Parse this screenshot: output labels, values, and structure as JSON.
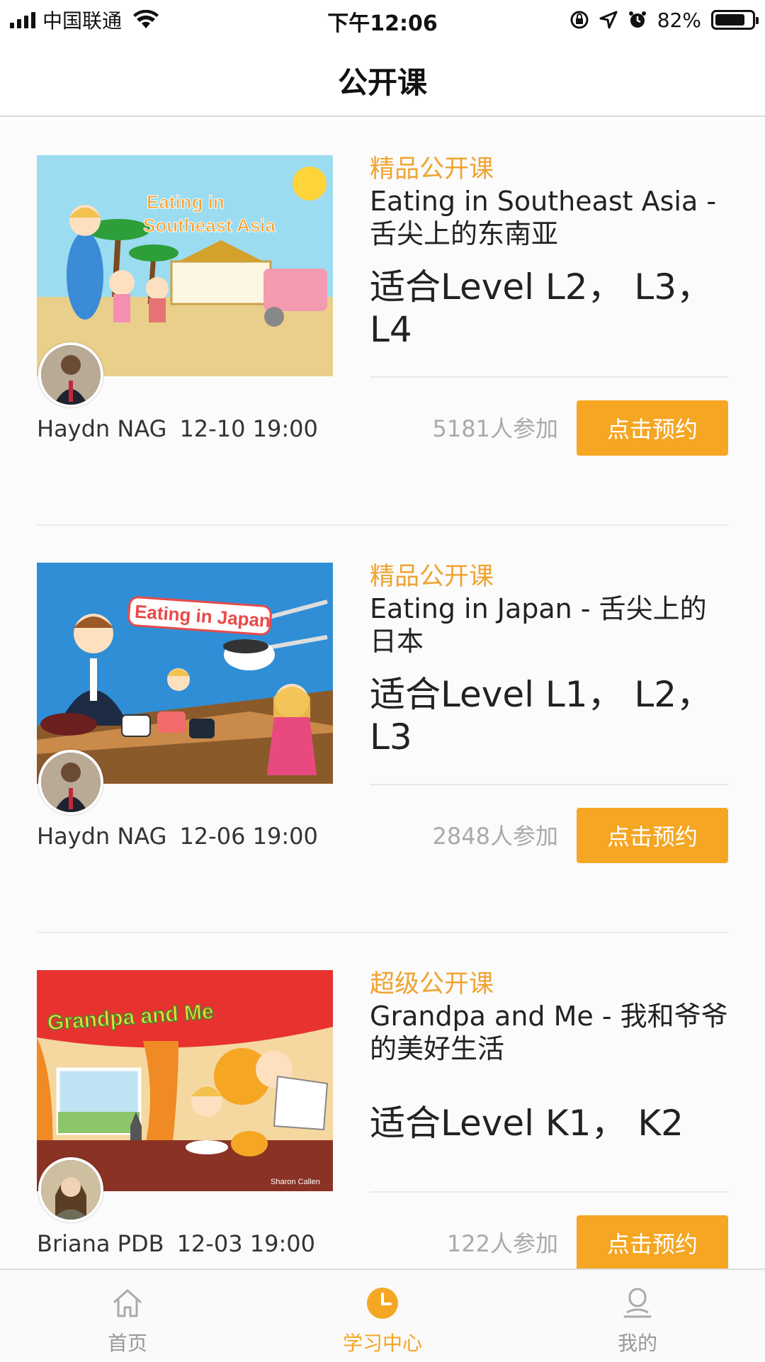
{
  "status_bar": {
    "carrier": "中国联通",
    "time": "下午12:06",
    "battery_percent": "82%",
    "battery_level": 0.82
  },
  "nav": {
    "title": "公开课"
  },
  "courses": [
    {
      "tag": "精品公开课",
      "title": "Eating in Southeast Asia - 舌尖上的东南亚",
      "level": "适合Level L2， L3， L4",
      "teacher": "Haydn NAG",
      "datetime": "12-10 19:00",
      "participants": "5181人参加",
      "button": "点击预约",
      "thumb_text": "Eating in Southeast Asia"
    },
    {
      "tag": "精品公开课",
      "title": "Eating in Japan - 舌尖上的日本",
      "level": "适合Level L1， L2， L3",
      "teacher": "Haydn NAG",
      "datetime": "12-06 19:00",
      "participants": "2848人参加",
      "button": "点击预约",
      "thumb_text": "Eating in Japan"
    },
    {
      "tag": "超级公开课",
      "title": "Grandpa and Me -  我和爷爷的美好生活",
      "level": "适合Level K1， K2",
      "teacher": "Briana PDB",
      "datetime": "12-03 19:00",
      "participants": "122人参加",
      "button": "点击预约",
      "thumb_text": "Grandpa and Me",
      "thumb_credit": "Sharon Callen"
    }
  ],
  "tabs": [
    {
      "label": "首页",
      "icon": "home-icon"
    },
    {
      "label": "学习中心",
      "icon": "clock-icon",
      "active": true
    },
    {
      "label": "我的",
      "icon": "person-icon"
    }
  ],
  "colors": {
    "accent": "#f5a623",
    "tag": "#f0a330"
  }
}
